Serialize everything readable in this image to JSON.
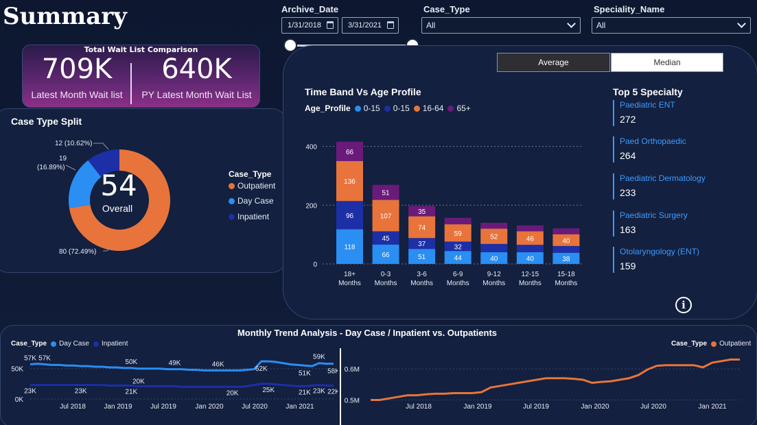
{
  "page": {
    "title": "Summary"
  },
  "filters": {
    "archive_date": {
      "label": "Archive_Date",
      "start": "1/31/2018",
      "end": "3/31/2021"
    },
    "case_type": {
      "label": "Case_Type",
      "value": "All"
    },
    "speciality_name": {
      "label": "Speciality_Name",
      "value": "All"
    }
  },
  "kpi": {
    "title": "Total Wait List Comparison",
    "latest": {
      "value": "709K",
      "label": "Latest Month Wait list"
    },
    "py_latest": {
      "value": "640K",
      "label": "PY Latest Month Wait List"
    }
  },
  "case_split": {
    "title": "Case Type Split",
    "center_value": "54",
    "center_label": "Overall",
    "legend_title": "Case_Type",
    "slices": [
      {
        "name": "Outpatient",
        "value": 80,
        "label": "80 (72.49%)",
        "pct": 72.49,
        "color": "#e8743b"
      },
      {
        "name": "Day Case",
        "value": 19,
        "label_line1": "19",
        "label_line2": "(16.89%)",
        "pct": 16.89,
        "color": "#2a8ef2"
      },
      {
        "name": "Inpatient",
        "value": 12,
        "label": "12 (10.62%)",
        "pct": 10.62,
        "color": "#1c2fa6"
      }
    ]
  },
  "toggle": {
    "average": "Average",
    "median": "Median"
  },
  "chart_data": [
    {
      "type": "bar",
      "title": "Time Band Vs Age Profile",
      "legend_title": "Age_Profile",
      "stacked": true,
      "categories": [
        "18+ Months",
        "0-3 Months",
        "3-6 Months",
        "6-9 Months",
        "9-12 Months",
        "12-15 Months",
        "15-18 Months"
      ],
      "category_lines": [
        [
          "18+",
          "Months"
        ],
        [
          "0-3",
          "Months"
        ],
        [
          "3-6",
          "Months"
        ],
        [
          "6-9",
          "Months"
        ],
        [
          "9-12",
          "Months"
        ],
        [
          "12-15",
          "Months"
        ],
        [
          "15-18",
          "Months"
        ]
      ],
      "series": [
        {
          "name": "0-15",
          "color": "#2a8ef2",
          "values": [
            118,
            66,
            51,
            44,
            40,
            40,
            38
          ]
        },
        {
          "name": "0-15",
          "color": "#1c2fa6",
          "values": [
            96,
            45,
            37,
            32,
            28,
            25,
            23
          ]
        },
        {
          "name": "16-64",
          "color": "#e8743b",
          "values": [
            136,
            107,
            74,
            59,
            52,
            46,
            40
          ]
        },
        {
          "name": "65+",
          "color": "#6a1b7a",
          "values": [
            66,
            51,
            35,
            22,
            20,
            20,
            20
          ]
        }
      ],
      "data_labels": [
        [
          "118",
          "66",
          "51",
          "44",
          "40",
          "40",
          "38"
        ],
        [
          "96",
          "45",
          "37",
          "32",
          "",
          "",
          ""
        ],
        [
          "136",
          "107",
          "74",
          "59",
          "52",
          "46",
          "40"
        ],
        [
          "66",
          "51",
          "35",
          "",
          "",
          "",
          ""
        ]
      ],
      "ylim": [
        0,
        420
      ],
      "yticks": [
        0,
        200,
        400
      ],
      "grid": true
    },
    {
      "type": "line",
      "title": "Monthly Trend Analysis - Day Case / Inpatient vs. Outpatients",
      "legend_title": "Case_Type",
      "xticks": [
        "Jul 2018",
        "Jan 2019",
        "Jul 2019",
        "Jan 2020",
        "Jul 2020",
        "Jan 2021"
      ],
      "yticks": [
        "0K",
        "50K"
      ],
      "series": [
        {
          "name": "Day Case",
          "color": "#2a8ef2",
          "values": [
            57,
            58,
            57,
            56,
            56,
            55,
            55,
            54,
            54,
            53,
            53,
            52,
            52,
            51,
            51,
            50,
            50,
            50,
            50,
            49,
            49,
            49,
            48,
            48,
            47,
            47,
            47,
            47,
            47,
            47,
            48,
            49,
            62,
            62,
            61,
            59,
            57,
            56,
            55,
            54,
            59,
            58,
            58
          ]
        },
        {
          "name": "Inpatient",
          "color": "#1c2fa6",
          "values": [
            23,
            23,
            23,
            23,
            23,
            23,
            23,
            23,
            23,
            23,
            23,
            22,
            22,
            22,
            22,
            21,
            21,
            21,
            21,
            21,
            21,
            20,
            20,
            20,
            20,
            20,
            20,
            20,
            20,
            20,
            21,
            23,
            25,
            25,
            24,
            23,
            22,
            21,
            21,
            22,
            23,
            22,
            22
          ]
        }
      ],
      "point_labels": [
        {
          "text": "57K",
          "i": 0,
          "series": 0
        },
        {
          "text": "57K",
          "i": 2,
          "series": 0
        },
        {
          "text": "49K",
          "i": 20,
          "series": 0
        },
        {
          "text": "50K",
          "i": 14,
          "series": 0
        },
        {
          "text": "46K",
          "i": 26,
          "series": 0
        },
        {
          "text": "62K",
          "i": 32,
          "series": 0
        },
        {
          "text": "59K",
          "i": 40,
          "series": 0
        },
        {
          "text": "51K",
          "i": 38,
          "series": 0
        },
        {
          "text": "58K",
          "i": 42,
          "series": 0
        },
        {
          "text": "23K",
          "i": 0,
          "series": 1
        },
        {
          "text": "23K",
          "i": 7,
          "series": 1
        },
        {
          "text": "20K",
          "i": 15,
          "series": 1
        },
        {
          "text": "21K",
          "i": 14,
          "series": 1
        },
        {
          "text": "20K",
          "i": 28,
          "series": 1
        },
        {
          "text": "25K",
          "i": 33,
          "series": 1
        },
        {
          "text": "21K",
          "i": 38,
          "series": 1
        },
        {
          "text": "23K",
          "i": 40,
          "series": 1
        },
        {
          "text": "22K",
          "i": 42,
          "series": 1
        }
      ]
    },
    {
      "type": "line",
      "legend_title": "Case_Type",
      "xticks": [
        "Jul 2018",
        "Jan 2019",
        "Jul 2019",
        "Jan 2020",
        "Jul 2020",
        "Jan 2021"
      ],
      "yticks": [
        "0.5M",
        "0.6M"
      ],
      "ylim": [
        0.49,
        0.64
      ],
      "series": [
        {
          "name": "Outpatient",
          "color": "#e8743b",
          "values": [
            0.5,
            0.5,
            0.505,
            0.51,
            0.515,
            0.515,
            0.518,
            0.52,
            0.52,
            0.522,
            0.522,
            0.522,
            0.525,
            0.54,
            0.545,
            0.55,
            0.555,
            0.56,
            0.565,
            0.57,
            0.57,
            0.57,
            0.568,
            0.565,
            0.555,
            0.558,
            0.56,
            0.565,
            0.57,
            0.58,
            0.598,
            0.61,
            0.612,
            0.612,
            0.612,
            0.612,
            0.605,
            0.62,
            0.625,
            0.63,
            0.63
          ]
        }
      ]
    }
  ],
  "top_specialty": {
    "title": "Top 5 Specialty",
    "items": [
      {
        "name": "Paediatric ENT",
        "value": "272"
      },
      {
        "name": "Paed Orthopaedic",
        "value": "264"
      },
      {
        "name": "Paediatric Dermatology",
        "value": "233"
      },
      {
        "name": "Paediatric Surgery",
        "value": "163"
      },
      {
        "name": "Otolaryngology (ENT)",
        "value": "159"
      }
    ]
  },
  "info": {
    "glyph": "i"
  }
}
